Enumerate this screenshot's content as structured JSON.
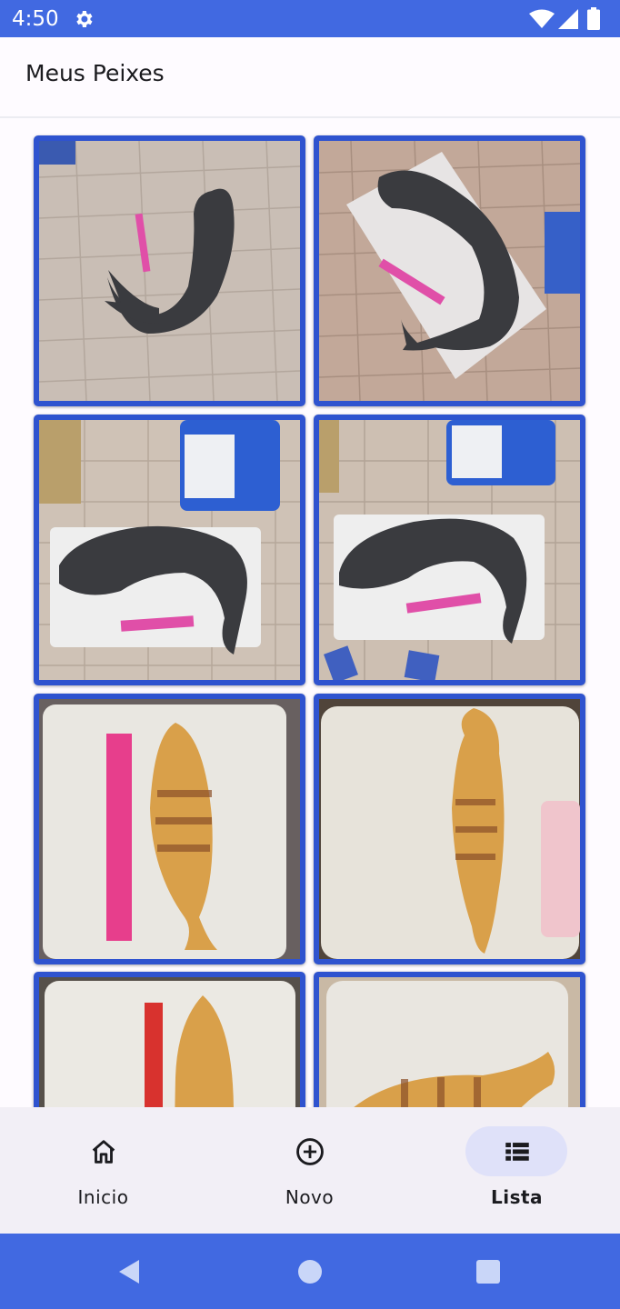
{
  "status_bar": {
    "time": "4:50",
    "icons": [
      "gear-icon",
      "wifi-icon",
      "signal-icon",
      "battery-icon"
    ]
  },
  "app_bar": {
    "title": "Meus Peixes"
  },
  "grid": {
    "items": [
      {
        "subject": "catfish",
        "color": "#3a3b3f"
      },
      {
        "subject": "catfish",
        "color": "#3a3b3f"
      },
      {
        "subject": "catfish",
        "color": "#3a3b3f"
      },
      {
        "subject": "catfish",
        "color": "#3a3b3f"
      },
      {
        "subject": "peacock-bass",
        "color": "#d9a04a"
      },
      {
        "subject": "peacock-bass",
        "color": "#d9a04a"
      },
      {
        "subject": "peacock-bass",
        "color": "#d9a04a"
      },
      {
        "subject": "peacock-bass",
        "color": "#d9a04a"
      }
    ]
  },
  "bottom_nav": {
    "items": [
      {
        "label": "Inicio",
        "icon": "home-icon",
        "active": false
      },
      {
        "label": "Novo",
        "icon": "add-circle-icon",
        "active": false
      },
      {
        "label": "Lista",
        "icon": "list-icon",
        "active": true
      }
    ]
  },
  "system_nav": {
    "buttons": [
      "back-icon",
      "home-circle-icon",
      "recents-icon"
    ]
  },
  "colors": {
    "primary": "#4169e1",
    "tile_border": "#2f53cf",
    "nav_active_pill": "#dfe1f9",
    "surface": "#fefbff",
    "nav_surface": "#f2eff6"
  }
}
